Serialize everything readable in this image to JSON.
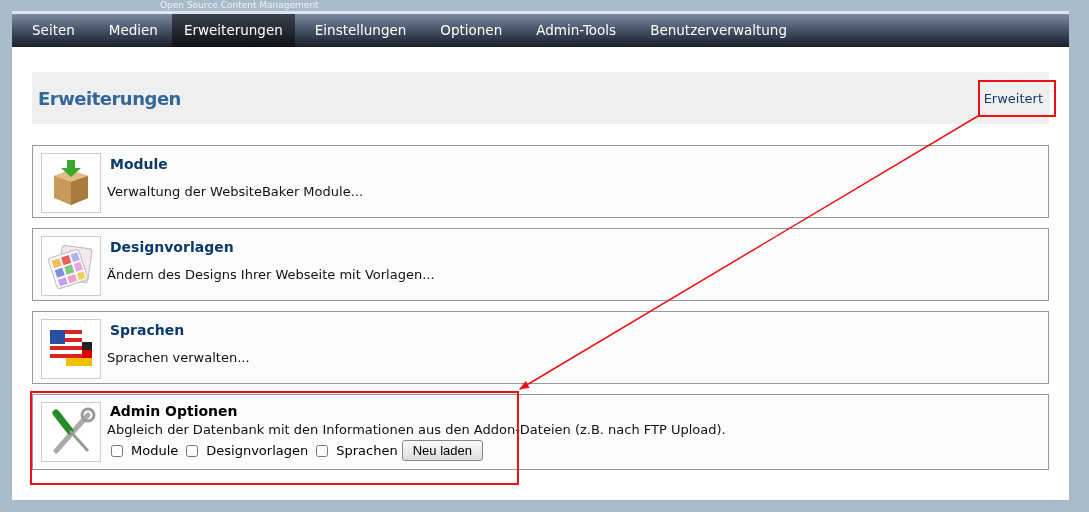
{
  "tagline": "Open Source Content Management",
  "nav": [
    {
      "label": "Seiten",
      "selected": false
    },
    {
      "label": "Medien",
      "selected": false
    },
    {
      "label": "Erweiterungen",
      "selected": true
    },
    {
      "label": "Einstellungen",
      "selected": false
    },
    {
      "label": "Optionen",
      "selected": false
    },
    {
      "label": "Admin-Tools",
      "selected": false
    },
    {
      "label": "Benutzerverwaltung",
      "selected": false
    }
  ],
  "header": {
    "title": "Erweiterungen",
    "link": "Erweitert"
  },
  "sections": [
    {
      "kind": "link",
      "title": "Module",
      "description": "Verwaltung der WebsiteBaker Module..."
    },
    {
      "kind": "link",
      "title": "Designvorlagen",
      "description": "Ändern des Designs Ihrer Webseite mit Vorlagen..."
    },
    {
      "kind": "link",
      "title": "Sprachen",
      "description": "Sprachen verwalten..."
    },
    {
      "kind": "admin",
      "title": "Admin Optionen",
      "description": "Abgleich der Datenbank mit den Informationen aus den Addon-Dateien (z.B. nach FTP Upload).",
      "options": [
        {
          "label": "Module",
          "checked": false
        },
        {
          "label": "Designvorlagen",
          "checked": false
        },
        {
          "label": "Sprachen",
          "checked": false
        }
      ],
      "button": "Neu laden"
    }
  ]
}
